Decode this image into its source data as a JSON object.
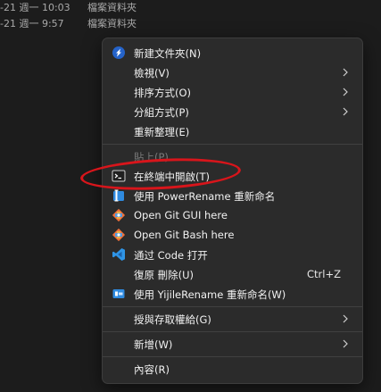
{
  "background_rows": [
    {
      "date": "-21 週一 10:03",
      "type": "檔案資料夾"
    },
    {
      "date": "-21 週一 9:57",
      "type": "檔案資料夾"
    }
  ],
  "menu": {
    "new_folder": "新建文件夾(N)",
    "view": "檢視(V)",
    "sort_by": "排序方式(O)",
    "group_by": "分組方式(P)",
    "refresh": "重新整理(E)",
    "paste": "貼上(P)",
    "open_in_terminal": "在終端中開啟(T)",
    "powerrename": "使用 PowerRename 重新命名",
    "git_gui": "Open Git GUI here",
    "git_bash": "Open Git Bash here",
    "open_with_code": "通过 Code 打开",
    "undo_delete": "復原 刪除(U)",
    "undo_shortcut": "Ctrl+Z",
    "yijile_rename": "使用  YijileRename  重新命名(W)",
    "give_access": "授與存取權給(G)",
    "new": "新增(W)",
    "properties": "內容(R)"
  },
  "colors": {
    "menu_bg": "#2b2b2b",
    "highlight_oval": "#d8151b",
    "vscode_blue": "#2f95e6",
    "git_orange": "#f0703a"
  }
}
